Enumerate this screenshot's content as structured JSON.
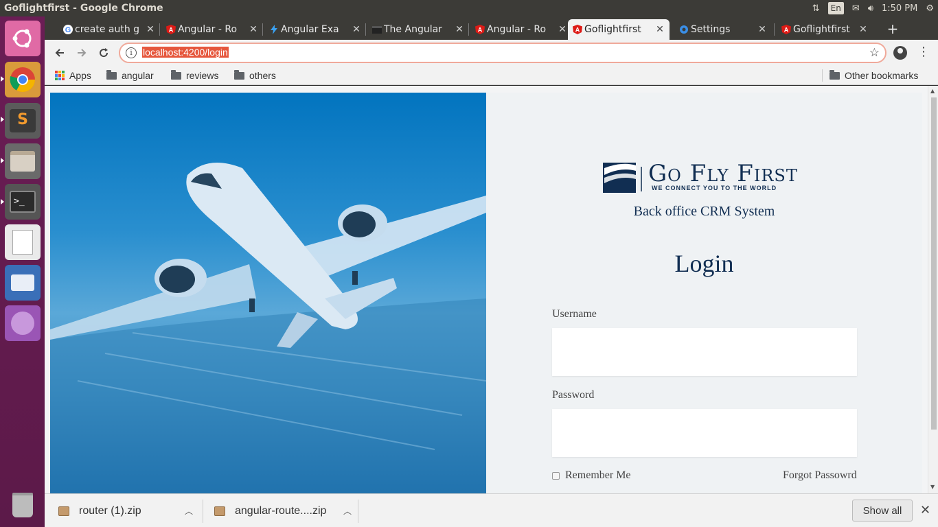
{
  "window": {
    "title": "Goflightfirst - Google Chrome"
  },
  "tray": {
    "network_icon": "network-updown-icon",
    "lang": "En",
    "mail_icon": "envelope-icon",
    "volume_icon": "volume-icon",
    "time": "1:50 PM",
    "gear_icon": "gear-icon"
  },
  "launcher": {
    "items": [
      {
        "name": "ubuntu-dash-icon",
        "color": "#d05a96"
      },
      {
        "name": "chrome-icon",
        "color": "#d9a03a"
      },
      {
        "name": "sublime-text-icon",
        "color": "#4a4a4a"
      },
      {
        "name": "files-icon",
        "color": "#5a5a5a"
      },
      {
        "name": "terminal-icon",
        "color": "#333333"
      },
      {
        "name": "text-editor-icon",
        "color": "#e8e8e8"
      },
      {
        "name": "thunderbird-icon",
        "color": "#3a6fb8"
      },
      {
        "name": "pidgin-icon",
        "color": "#8e4aa6"
      },
      {
        "name": "trash-icon",
        "color": "#7a7a7a"
      }
    ]
  },
  "tabs": [
    {
      "label": "create auth g",
      "icon": "google-icon"
    },
    {
      "label": "Angular - Ro",
      "icon": "angular-icon"
    },
    {
      "label": "Angular Exa",
      "icon": "bolt-icon"
    },
    {
      "label": "The Angular",
      "icon": "clapper-icon"
    },
    {
      "label": "Angular - Ro",
      "icon": "angular-icon"
    },
    {
      "label": "Goflightfirst",
      "icon": "angular-icon",
      "active": true
    },
    {
      "label": "Settings",
      "icon": "settings-gear-icon"
    },
    {
      "label": "Goflightfirst",
      "icon": "angular-icon"
    }
  ],
  "toolbar": {
    "url": "localhost:4200/login"
  },
  "bookmarks": {
    "apps": "Apps",
    "items": [
      "angular",
      "reviews",
      "others"
    ],
    "other": "Other bookmarks"
  },
  "page": {
    "brand": "Go Fly First",
    "tagline": "WE CONNECT YOU TO THE WORLD",
    "subtitle": "Back office CRM System",
    "title": "Login",
    "username_label": "Username",
    "username_value": "",
    "password_label": "Password",
    "password_value": "",
    "remember_label": "Remember Me",
    "forgot_label": "Forgot Passowrd",
    "brand_color": "#112e52"
  },
  "downloads": {
    "items": [
      {
        "name": "router (1).zip"
      },
      {
        "name": "angular-route....zip"
      }
    ],
    "show_all": "Show all"
  }
}
